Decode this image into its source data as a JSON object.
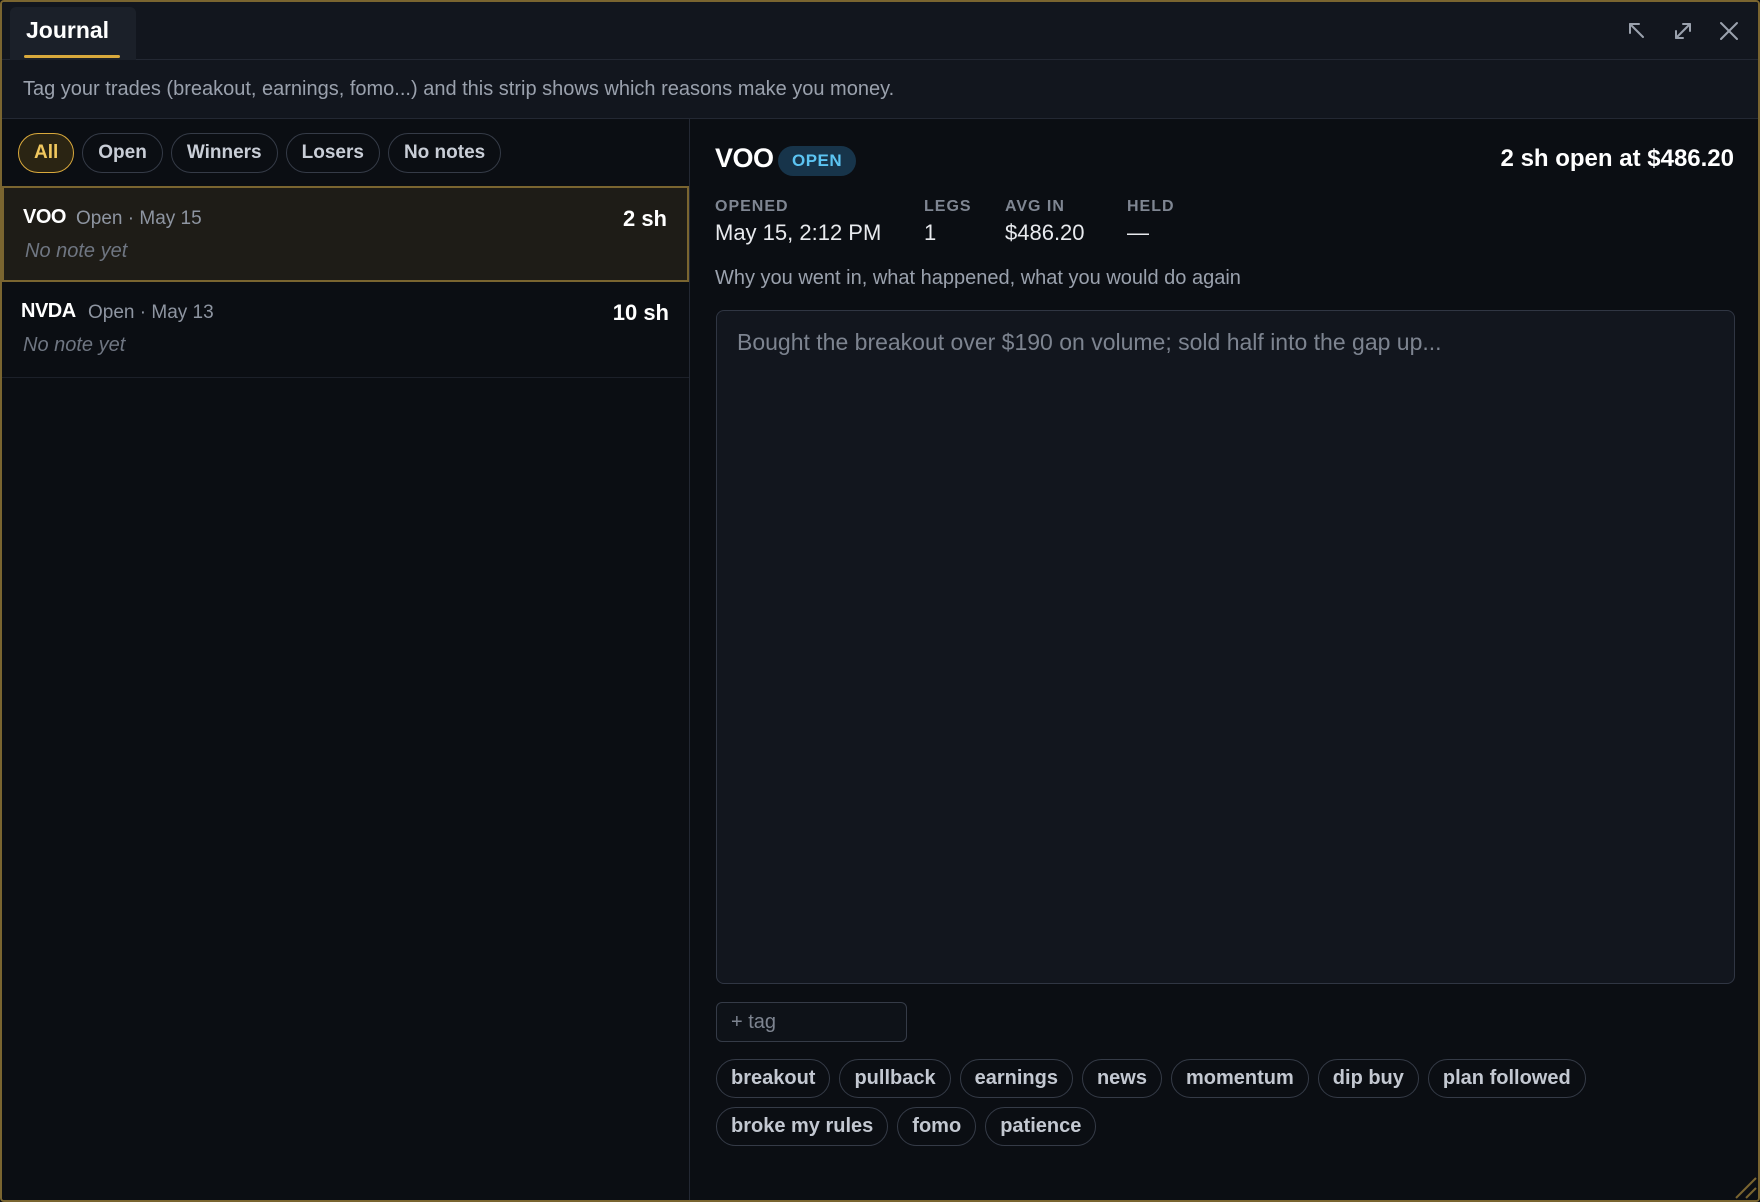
{
  "window": {
    "tab_label": "Journal",
    "controls": [
      "pop-out-icon",
      "expand-icon",
      "close-icon"
    ],
    "accent_color": "#d9a93c"
  },
  "info_strip": {
    "text": "Tag your trades (breakout, earnings, fomo...) and this strip shows which reasons make you money."
  },
  "filters": [
    {
      "label": "All",
      "active": true
    },
    {
      "label": "Open",
      "active": false
    },
    {
      "label": "Winners",
      "active": false
    },
    {
      "label": "Losers",
      "active": false
    },
    {
      "label": "No notes",
      "active": false
    }
  ],
  "trades": [
    {
      "symbol": "VOO",
      "meta": "Open · May 15",
      "qty": "2 sh",
      "note": "No note yet",
      "selected": true
    },
    {
      "symbol": "NVDA",
      "meta": "Open · May 13",
      "qty": "10 sh",
      "note": "No note yet",
      "selected": false
    }
  ],
  "detail": {
    "symbol": "VOO",
    "status": "OPEN",
    "status_color": "#5cc4f2",
    "summary": "2 sh open at $486.20",
    "stats": [
      {
        "label": "OPENED",
        "value": "May 15, 2:12 PM"
      },
      {
        "label": "LEGS",
        "value": "1"
      },
      {
        "label": "AVG IN",
        "value": "$486.20"
      },
      {
        "label": "HELD",
        "value": "—"
      }
    ],
    "prompt": "Why you went in, what happened, what you would do again",
    "note_value": "",
    "note_placeholder": "Bought the breakout over $190 on volume; sold half into the gap up...",
    "tag_input_value": "",
    "tag_input_placeholder": "+ tag",
    "tag_suggestions_row1": [
      "breakout",
      "pullback",
      "earnings",
      "news",
      "momentum",
      "dip buy",
      "plan followed"
    ],
    "tag_suggestions_row2": [
      "broke my rules",
      "fomo",
      "patience"
    ]
  }
}
